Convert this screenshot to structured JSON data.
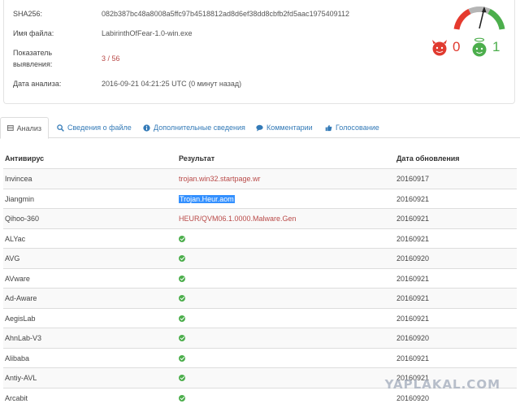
{
  "info": {
    "sha_label": "SHA256:",
    "sha_value": "082b387bc48a8008a5ffc97b4518812ad8d6ef38dd8cbfb2fd5aac1975409112",
    "file_label": "Имя файла:",
    "file_value": "LabirinthOfFear-1.0-win.exe",
    "ratio_label_1": "Показатель",
    "ratio_label_2": "выявления:",
    "ratio_value": "3 / 56",
    "date_label": "Дата анализа:",
    "date_value": "2016-09-21 04:21:25 UTC (0 минут назад)"
  },
  "score": {
    "malicious": "0",
    "harmless": "1"
  },
  "tabs": [
    {
      "label": "Анализ",
      "icon": "table-icon"
    },
    {
      "label": "Сведения о файле",
      "icon": "search-icon"
    },
    {
      "label": "Дополнительные сведения",
      "icon": "info-circle-icon"
    },
    {
      "label": "Комментарии",
      "icon": "comment-icon"
    },
    {
      "label": "Голосование",
      "icon": "thumbs-icon"
    }
  ],
  "table": {
    "headers": [
      "Антивирус",
      "Результат",
      "Дата обновления"
    ],
    "rows": [
      {
        "av": "Invincea",
        "result": "trojan.win32.startpage.wr",
        "date": "20160917"
      },
      {
        "av": "Jiangmin",
        "result": "Trojan.Heur.aom",
        "date": "20160921"
      },
      {
        "av": "Qihoo-360",
        "result": "HEUR/QVM06.1.0000.Malware.Gen",
        "date": "20160921"
      },
      {
        "av": "ALYac",
        "result": "",
        "date": "20160921"
      },
      {
        "av": "AVG",
        "result": "",
        "date": "20160920"
      },
      {
        "av": "AVware",
        "result": "",
        "date": "20160921"
      },
      {
        "av": "Ad-Aware",
        "result": "",
        "date": "20160921"
      },
      {
        "av": "AegisLab",
        "result": "",
        "date": "20160921"
      },
      {
        "av": "AhnLab-V3",
        "result": "",
        "date": "20160920"
      },
      {
        "av": "Alibaba",
        "result": "",
        "date": "20160921"
      },
      {
        "av": "Antiy-AVL",
        "result": "",
        "date": "20160921"
      },
      {
        "av": "Arcabit",
        "result": "",
        "date": "20160920"
      }
    ]
  },
  "watermark": "YAPLAKAL.COM",
  "colors": {
    "link": "#337ab7",
    "detected": "#b94a48",
    "clean": "#4cae4c",
    "selection": "#3390ff"
  }
}
